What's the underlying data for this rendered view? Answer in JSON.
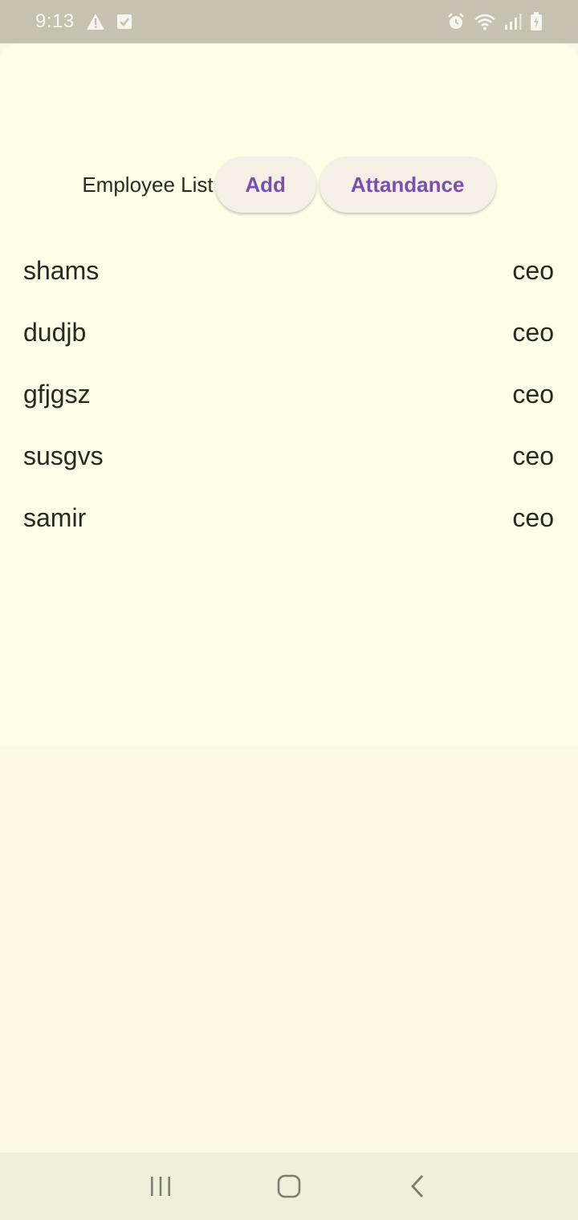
{
  "status_bar": {
    "time": "9:13",
    "icons_left": [
      "warning-icon",
      "checkbox-icon"
    ],
    "icons_right": [
      "alarm-icon",
      "wifi-icon",
      "signal-icon",
      "battery-icon"
    ]
  },
  "header": {
    "title": "Employee List",
    "add_label": "Add",
    "attendance_label": "Attandance"
  },
  "employees": [
    {
      "name": "shams",
      "role": "ceo"
    },
    {
      "name": "dudjb",
      "role": "ceo"
    },
    {
      "name": "gfjgsz",
      "role": "ceo"
    },
    {
      "name": "susgvs",
      "role": "ceo"
    },
    {
      "name": "samir",
      "role": "ceo"
    }
  ],
  "nav_bar": {
    "icons": [
      "recent-apps-icon",
      "home-icon",
      "back-icon"
    ]
  },
  "colors": {
    "accent": "#7b4fb0",
    "sheet_bg": "#fffde8",
    "page_bg": "#fdf7e7",
    "status_bar_bg": "#c6c1b0",
    "nav_bar_bg": "#f1eedc"
  }
}
